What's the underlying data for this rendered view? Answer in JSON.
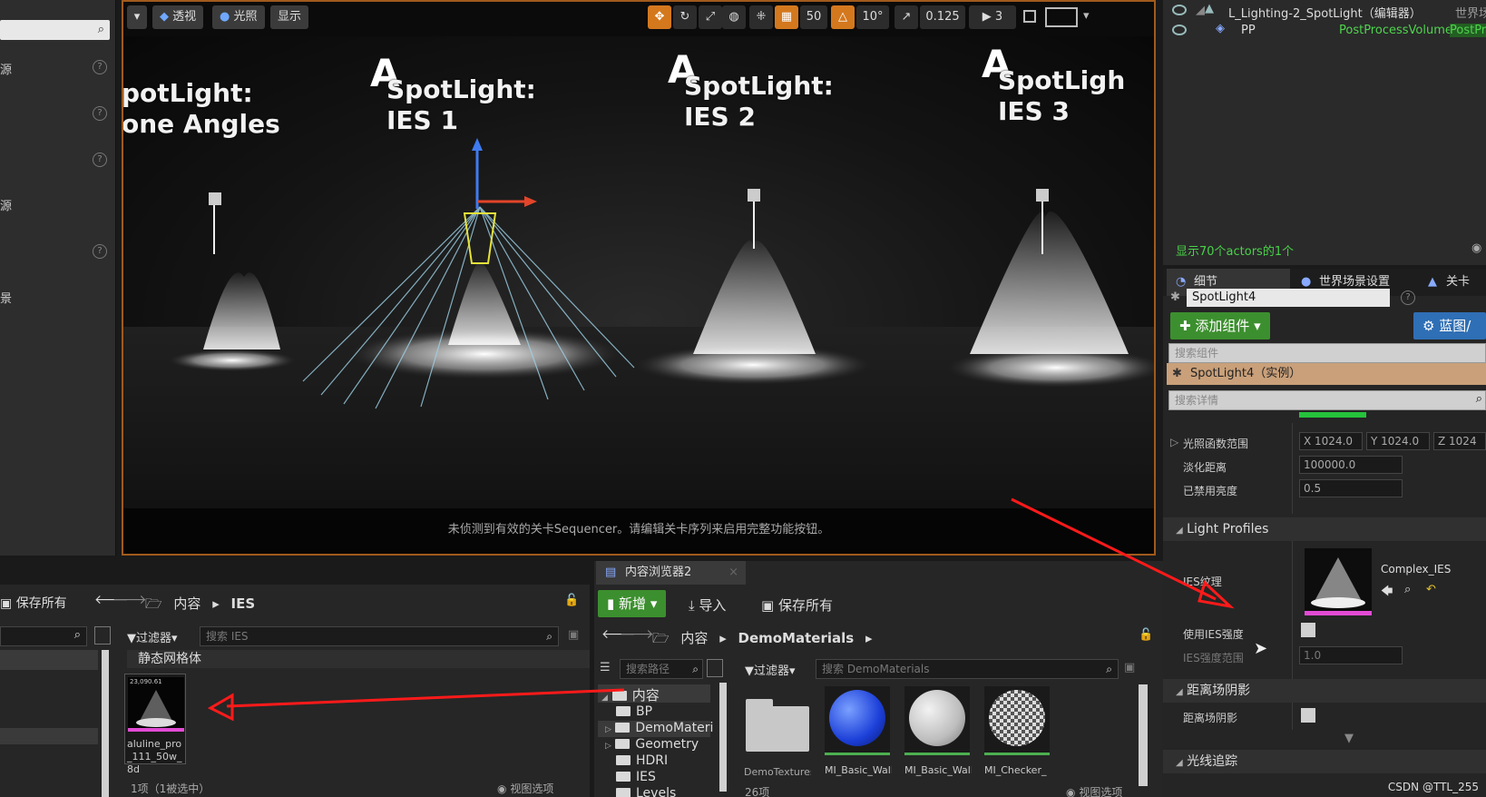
{
  "left_panel": {
    "items": [
      {
        "label": "源"
      },
      {
        "label": ""
      },
      {
        "label": ""
      },
      {
        "label": "源"
      },
      {
        "label": ""
      },
      {
        "label": "景"
      }
    ]
  },
  "viewport_toolbar": {
    "perspective": "透视",
    "lit": "光照",
    "show": "显示",
    "grid_snap": "50",
    "rotation_snap": "10°",
    "scale_snap": "0.125",
    "camera_speed": "3"
  },
  "viewport": {
    "sequencer_message": "未侦测到有效的关卡Sequencer。请编辑关卡序列来启用完整功能按钮。",
    "labels": [
      {
        "letter": "",
        "line1": "potLight:",
        "line2": "one Angles"
      },
      {
        "letter": "A",
        "line1": "SpotLight:",
        "line2": "IES 1"
      },
      {
        "letter": "A",
        "line1": "SpotLight:",
        "line2": "IES 2"
      },
      {
        "letter": "A",
        "line1": "SpotLigh",
        "line2": "IES 3"
      }
    ]
  },
  "outliner": {
    "rows": [
      {
        "name": "L_Lighting-2_SpotLight（编辑器）",
        "type": "世界场"
      },
      {
        "name": "PP",
        "type": "PostProcessVolume",
        "extra": "PostPr"
      }
    ],
    "footer": "显示70个actors的1个"
  },
  "details": {
    "tabs": [
      "细节",
      "世界场景设置",
      "关卡"
    ],
    "actor_name": "SpotLight4",
    "add_component": "添加组件",
    "blueprint": "蓝图/",
    "search_components": "搜索组件",
    "component_instance": "SpotLight4（实例）",
    "search_details": "搜索详情",
    "props": {
      "light_function_scale_label": "光照函数范围",
      "lfs_x": "X 1024.0",
      "lfs_y": "Y 1024.0",
      "lfs_z": "Z 1024",
      "fade_distance_label": "淡化距离",
      "fade_distance": "100000.0",
      "disabled_brightness_label": "已禁用亮度",
      "disabled_brightness": "0.5"
    },
    "light_profiles": {
      "title": "Light Profiles",
      "ies_texture_label": "IES纹理",
      "ies_asset": "Complex_IES",
      "use_ies_intensity_label": "使用IES强度",
      "ies_intensity_scale_label": "IES强度范围",
      "ies_intensity_scale": "1.0"
    },
    "distance_field": {
      "title": "距离场阴影",
      "label": "距离场阴影"
    },
    "ray_tracing": {
      "title": "光线追踪"
    }
  },
  "content_browser_left": {
    "save_all": "保存所有",
    "path": [
      "内容",
      "IES"
    ],
    "filter": "过滤器",
    "search_placeholder": "搜索 IES",
    "group": "静态网格体",
    "asset": {
      "name": "aluline_pro_111_50w_8d",
      "thumb_text": "23,090.61"
    },
    "status": "1项（1被选中）",
    "view_options": "视图选项"
  },
  "content_browser_right": {
    "tab": "内容浏览器2",
    "new": "新增",
    "import": "导入",
    "save_all": "保存所有",
    "path": [
      "内容",
      "DemoMaterials"
    ],
    "search_path_placeholder": "搜索路径",
    "filter": "过滤器",
    "search_placeholder": "搜索 DemoMaterials",
    "tree": [
      {
        "label": "内容",
        "depth": 0
      },
      {
        "label": "BP",
        "depth": 1
      },
      {
        "label": "DemoMateri",
        "depth": 1
      },
      {
        "label": "Geometry",
        "depth": 1
      },
      {
        "label": "HDRI",
        "depth": 1
      },
      {
        "label": "IES",
        "depth": 1
      },
      {
        "label": "Levels",
        "depth": 1
      }
    ],
    "assets": [
      {
        "name": "DemoTextures"
      },
      {
        "name": "MI_Basic_Wall_"
      },
      {
        "name": "MI_Basic_Wall_"
      },
      {
        "name": "MI_Checker_"
      }
    ],
    "status": "26项",
    "view_options": "视图选项"
  },
  "watermark": "CSDN @TTL_255",
  "colors": {
    "accent_orange": "#d4781e",
    "green": "#3c8f2e",
    "blue": "#2f6fb5",
    "arrow_red": "#ff1a1a"
  }
}
